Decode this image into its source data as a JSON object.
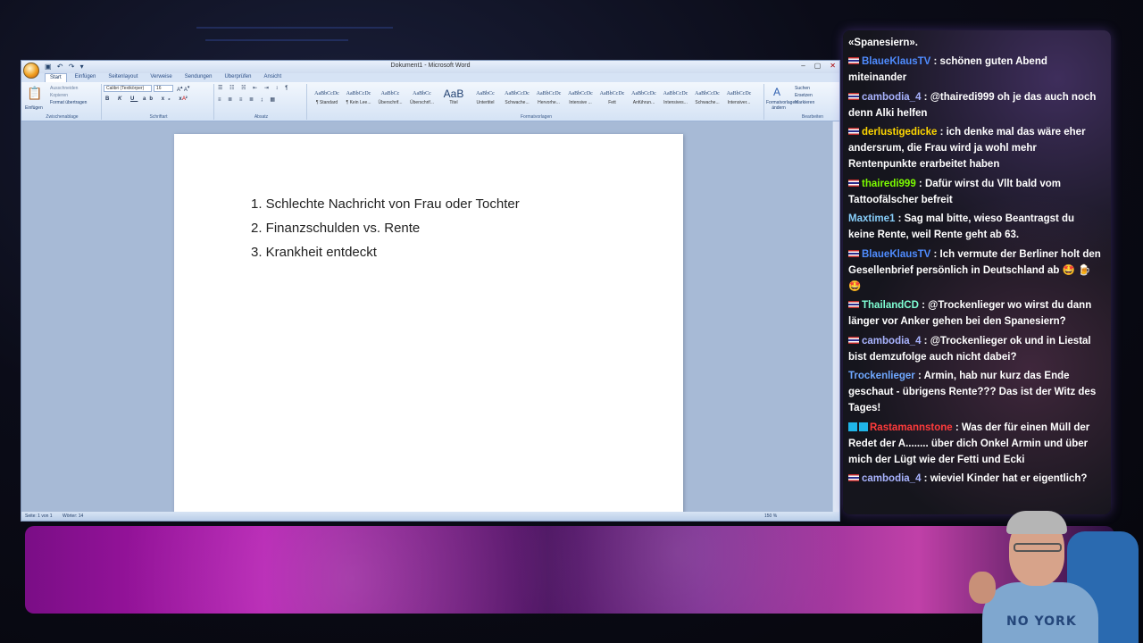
{
  "word": {
    "window_title": "Dokument1 - Microsoft Word",
    "tabs": [
      "Start",
      "Einfügen",
      "Seitenlayout",
      "Verweise",
      "Sendungen",
      "Überprüfen",
      "Ansicht"
    ],
    "clipboard": {
      "paste": "Einfügen",
      "cut": "Ausschneiden",
      "copy": "Kopieren",
      "format_painter": "Format übertragen",
      "label": "Zwischenablage"
    },
    "font": {
      "name": "Calibri (Textkörper)",
      "size": "16",
      "label": "Schriftart"
    },
    "paragraph_label": "Absatz",
    "styles": [
      {
        "sample": "AaBbCcDc",
        "name": "¶ Standard"
      },
      {
        "sample": "AaBbCcDc",
        "name": "¶ Kein Lee..."
      },
      {
        "sample": "AaBbCc",
        "name": "Überschrif..."
      },
      {
        "sample": "AaBbCc",
        "name": "Überschrif..."
      },
      {
        "sample": "AaB",
        "name": "Titel"
      },
      {
        "sample": "AaBbCc",
        "name": "Untertitel"
      },
      {
        "sample": "AaBbCcDc",
        "name": "Schwache..."
      },
      {
        "sample": "AaBbCcDc",
        "name": "Hervorhe..."
      },
      {
        "sample": "AaBbCcDc",
        "name": "Intensive ..."
      },
      {
        "sample": "AaBbCcDc",
        "name": "Fett"
      },
      {
        "sample": "AaBbCcDc",
        "name": "Anführun..."
      },
      {
        "sample": "AaBbCcDc",
        "name": "Intensives..."
      },
      {
        "sample": "AaBbCcDc",
        "name": "Schwache..."
      },
      {
        "sample": "AaBbCcDc",
        "name": "Intensiver..."
      }
    ],
    "styles_group_label": "Formatvorlagen",
    "change_styles": "Formatvorlagen ändern",
    "editing": {
      "find": "Suchen",
      "replace": "Ersetzen",
      "select": "Markieren",
      "label": "Bearbeiten"
    },
    "document_lines": [
      "1.  Schlechte Nachricht von Frau oder Tochter",
      "2. Finanzschulden vs. Rente",
      "3. Krankheit entdeckt"
    ],
    "status": {
      "page": "Seite: 1 von 1",
      "words": "Wörter: 14",
      "zoom": "150 %"
    }
  },
  "chat": {
    "messages": [
      {
        "user": "",
        "user_color": "#ffffff",
        "flag": false,
        "text": "«Spanesiern»."
      },
      {
        "user": "BlaueKlausTV",
        "user_color": "#4f8cff",
        "flag": true,
        "text": " : schönen guten Abend miteinander"
      },
      {
        "user": "cambodia_4",
        "user_color": "#a9b4ff",
        "flag": true,
        "text": " : @thairedi999 oh je das auch noch denn Alki helfen"
      },
      {
        "user": "derlustigedicke",
        "user_color": "#ffd700",
        "flag": true,
        "text": " : ich denke mal das wäre eher andersrum, die Frau wird ja wohl mehr Rentenpunkte erarbeitet haben"
      },
      {
        "user": "thairedi999",
        "user_color": "#7cfc00",
        "flag": true,
        "text": " : Dafür wirst du Vllt bald vom Tattoofälscher befreit"
      },
      {
        "user": "Maxtime1",
        "user_color": "#87cefa",
        "flag": false,
        "text": " : Sag mal bitte, wieso Beantragst du keine Rente, weil Rente geht ab 63."
      },
      {
        "user": "BlaueKlausTV",
        "user_color": "#4f8cff",
        "flag": true,
        "text": " : Ich vermute der Berliner holt den Gesellenbrief persönlich in Deutschland ab 🤩 🍺🤩"
      },
      {
        "user": "ThailandCD",
        "user_color": "#7fffd4",
        "flag": true,
        "text": " : @Trockenlieger wo wirst du dann länger vor Anker gehen bei den Spanesiern?"
      },
      {
        "user": "cambodia_4",
        "user_color": "#a9b4ff",
        "flag": true,
        "text": " : @Trockenlieger ok und in Liestal bist demzufolge auch nicht dabei?"
      },
      {
        "user": "Trockenlieger",
        "user_color": "#6fa8ff",
        "flag": false,
        "text": " : Armin, hab nur kurz das Ende geschaut - übrigens Rente??? Das ist der Witz des Tages!"
      },
      {
        "user": "Rastamannstone",
        "user_color": "#ff3b3b",
        "flag": false,
        "badges": true,
        "text": " : Was der für einen Müll der Redet der A........ über dich Onkel Armin und über mich der Lügt wie der Fetti und Ecki"
      },
      {
        "user": "cambodia_4",
        "user_color": "#a9b4ff",
        "flag": true,
        "text": " : wieviel Kinder hat er eigentlich?"
      }
    ]
  },
  "webcam": {
    "shirt_text": "NO YORK"
  }
}
